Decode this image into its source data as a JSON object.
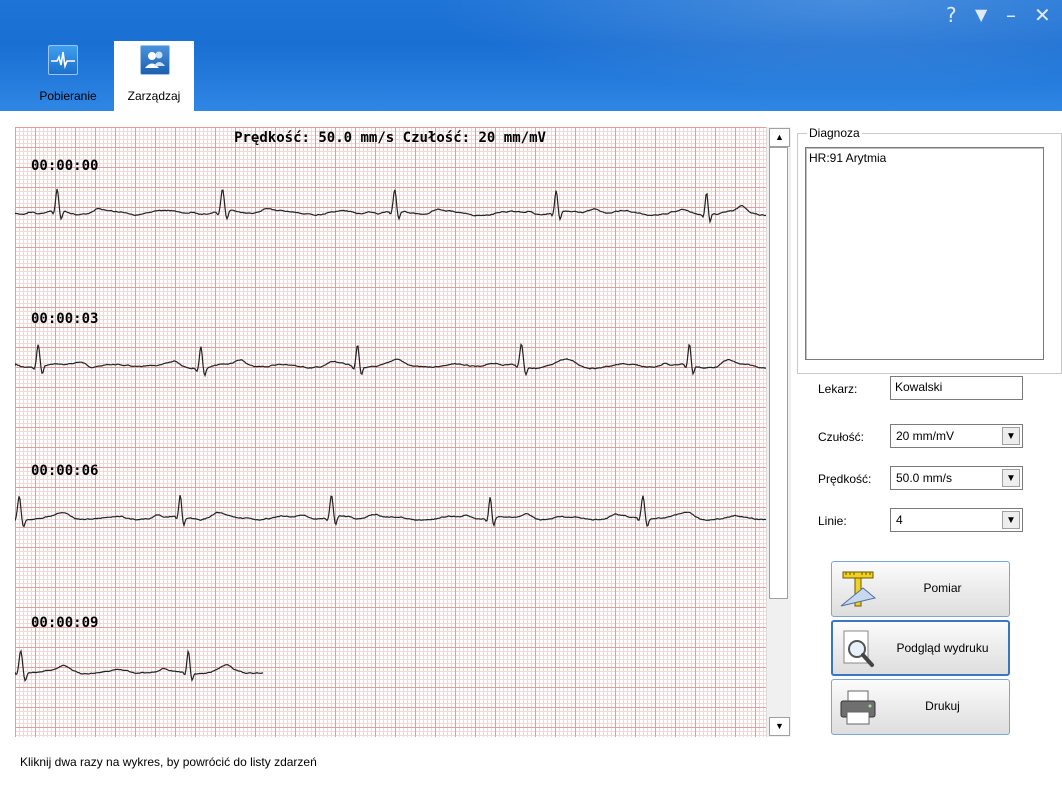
{
  "window_controls": {
    "help": "?",
    "menu": "▼",
    "minimize": "–",
    "close": "✕"
  },
  "tabs": [
    {
      "label": "Pobieranie",
      "icon": "ecg-download-icon",
      "active": false
    },
    {
      "label": "Zarządzaj",
      "icon": "users-icon",
      "active": true
    }
  ],
  "ecg": {
    "title": "Prędkość: 50.0 mm/s  Czułość: 20 mm/mV",
    "lines": [
      {
        "timestamp": "00:00:00"
      },
      {
        "timestamp": "00:00:03"
      },
      {
        "timestamp": "00:00:06"
      },
      {
        "timestamp": "00:00:09"
      }
    ],
    "grid_colors": {
      "major": "#e99a9a",
      "minor": "#f7d6d6",
      "trace": "#222222"
    }
  },
  "diagnosis": {
    "legend": "Diagnoza",
    "text": "HR:91  Arytmia"
  },
  "form": {
    "doctor_label": "Lekarz:",
    "doctor_value": "Kowalski",
    "sensitivity_label": "Czułość:",
    "sensitivity_value": "20 mm/mV",
    "speed_label": "Prędkość:",
    "speed_value": "50.0 mm/s",
    "lines_label": "Linie:",
    "lines_value": "4"
  },
  "buttons": {
    "measure": "Pomiar",
    "preview": "Podgląd wydruku",
    "print": "Drukuj"
  },
  "status": "Kliknij dwa razy na wykres, by powrócić do listy zdarzeń"
}
